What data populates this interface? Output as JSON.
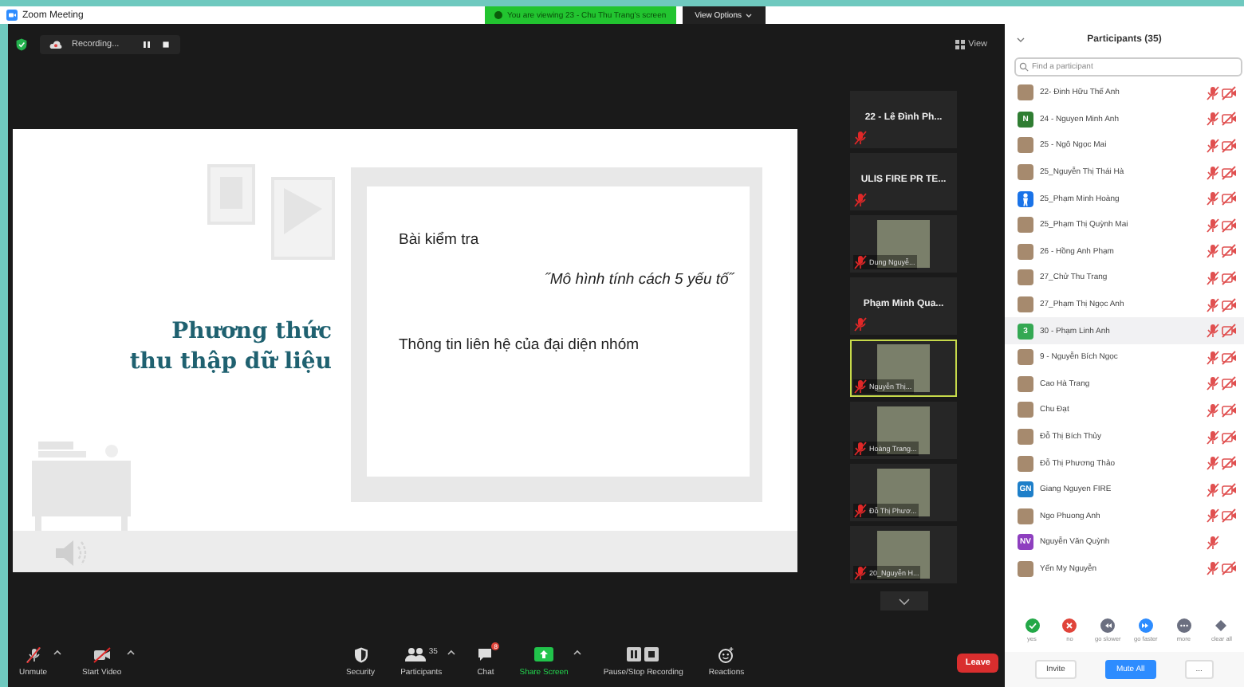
{
  "window": {
    "title": "Zoom Meeting"
  },
  "share_banner": {
    "text": "You are viewing 23 - Chu Thu Trang's screen",
    "button": "View Options"
  },
  "top_bar": {
    "recording": "Recording...",
    "view": "View"
  },
  "slide": {
    "title_lines": [
      "Phương thức",
      "thu thập dữ liệu"
    ],
    "box_lines": [
      {
        "text": "Bài kiểm tra",
        "kind": "plain"
      },
      {
        "text": "˝Mô hình tính cách 5 yếu tố˝",
        "kind": "quote"
      },
      {
        "text": "Thông tin liên hệ của đại diện nhóm",
        "kind": "plain"
      }
    ]
  },
  "video_strip": [
    {
      "name": "22 - Lê Đình Ph...",
      "kind": "name",
      "active": false,
      "mic_muted": true
    },
    {
      "name": "ULIS FIRE PR TE...",
      "kind": "name",
      "active": false,
      "mic_muted": true
    },
    {
      "name": "Dung Nguyễ...",
      "kind": "photo",
      "active": false,
      "mic_muted": true
    },
    {
      "name": "Phạm Minh Qua...",
      "kind": "name",
      "active": false,
      "mic_muted": true
    },
    {
      "name": "Nguyễn Thị...",
      "kind": "photo",
      "active": true,
      "mic_muted": true
    },
    {
      "name": "Hoàng Trang...",
      "kind": "photo",
      "active": false,
      "mic_muted": true
    },
    {
      "name": "Đỗ Thị Phươ...",
      "kind": "photo",
      "active": false,
      "mic_muted": true
    },
    {
      "name": "20_Nguyễn H...",
      "kind": "photo",
      "active": false,
      "mic_muted": true
    }
  ],
  "toolbar": {
    "left": [
      {
        "label": "Unmute",
        "kind": "mic",
        "menu": true
      },
      {
        "label": "Start Video",
        "kind": "video",
        "menu": true
      }
    ],
    "center": [
      {
        "label": "Security",
        "kind": "security",
        "menu": false
      },
      {
        "label": "Participants",
        "kind": "participants",
        "count": "35",
        "menu": true
      },
      {
        "label": "Chat",
        "kind": "chat",
        "badge": "8",
        "menu": false
      },
      {
        "label": "Share Screen",
        "kind": "share",
        "menu": true
      },
      {
        "label": "Pause/Stop Recording",
        "kind": "recording",
        "menu": false
      },
      {
        "label": "Reactions",
        "kind": "reactions",
        "menu": false
      }
    ],
    "leave": "Leave"
  },
  "participants": {
    "title": "Participants (35)",
    "search": {
      "placeholder": "Find a participant"
    },
    "items": [
      {
        "name": "22- Đinh Hữu Thế Anh",
        "kind": "photo",
        "mic_muted": true,
        "video_off": true,
        "selected": false
      },
      {
        "name": "24 - Nguyen Minh Anh",
        "kind": "initials",
        "initials": "N",
        "color": "#2f7d32",
        "mic_muted": true,
        "video_off": true,
        "selected": false
      },
      {
        "name": "25 - Ngô Ngọc Mai",
        "kind": "photo",
        "mic_muted": true,
        "video_off": true,
        "selected": false
      },
      {
        "name": "25_Nguyễn Thị Thái Hà",
        "kind": "photo",
        "mic_muted": true,
        "video_off": true,
        "selected": false
      },
      {
        "name": "25_Phạm Minh Hoàng",
        "kind": "person",
        "color": "#1a73e8",
        "mic_muted": true,
        "video_off": true,
        "selected": false
      },
      {
        "name": "25_Phạm Thị Quỳnh Mai",
        "kind": "photo",
        "mic_muted": true,
        "video_off": true,
        "selected": false
      },
      {
        "name": "26 - Hồng Anh Phạm",
        "kind": "photo",
        "mic_muted": true,
        "video_off": true,
        "selected": false
      },
      {
        "name": "27_Chử Thu Trang",
        "kind": "photo",
        "mic_muted": true,
        "video_off": true,
        "selected": false
      },
      {
        "name": "27_Phạm Thị Ngọc Anh",
        "kind": "photo",
        "mic_muted": true,
        "video_off": true,
        "selected": false
      },
      {
        "name": "30 - Phạm Linh Anh",
        "kind": "initials",
        "initials": "3",
        "color": "#34a853",
        "mic_muted": true,
        "video_off": true,
        "selected": true
      },
      {
        "name": "9 - Nguyễn Bích Ngọc",
        "kind": "photo",
        "mic_muted": true,
        "video_off": true,
        "selected": false
      },
      {
        "name": "Cao Hà Trang",
        "kind": "photo",
        "mic_muted": true,
        "video_off": true,
        "selected": false
      },
      {
        "name": "Chu Đạt",
        "kind": "photo",
        "mic_muted": true,
        "video_off": true,
        "selected": false
      },
      {
        "name": "Đỗ Thị Bích Thủy",
        "kind": "photo",
        "mic_muted": true,
        "video_off": true,
        "selected": false
      },
      {
        "name": "Đỗ Thị Phương Thảo",
        "kind": "photo",
        "mic_muted": true,
        "video_off": true,
        "selected": false
      },
      {
        "name": "Giang Nguyen FIRE",
        "kind": "initials",
        "initials": "GN",
        "color": "#1e7fc9",
        "mic_muted": true,
        "video_off": true,
        "selected": false
      },
      {
        "name": "Ngo Phuong Anh",
        "kind": "photo",
        "mic_muted": true,
        "video_off": true,
        "selected": false
      },
      {
        "name": "Nguyễn Văn Quỳnh",
        "kind": "initials",
        "initials": "NV",
        "color": "#8e3fbf",
        "mic_muted": true,
        "video_off": false,
        "selected": false
      },
      {
        "name": "Yến My Nguyễn",
        "kind": "photo",
        "mic_muted": true,
        "video_off": true,
        "selected": false
      }
    ],
    "reactions": [
      {
        "label": "yes",
        "kind": "yes"
      },
      {
        "label": "no",
        "kind": "no"
      },
      {
        "label": "go slower",
        "kind": "slower"
      },
      {
        "label": "go faster",
        "kind": "faster"
      },
      {
        "label": "more",
        "kind": "more"
      },
      {
        "label": "clear all",
        "kind": "clear"
      }
    ],
    "buttons": [
      {
        "label": "Invite",
        "kind": "plain"
      },
      {
        "label": "Mute All",
        "kind": "primary"
      },
      {
        "label": "...",
        "kind": "plain"
      }
    ]
  }
}
